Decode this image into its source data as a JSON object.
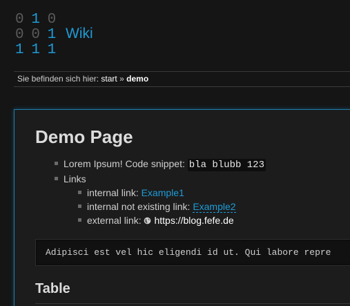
{
  "logo": {
    "rows": [
      [
        "0",
        "1",
        "0"
      ],
      [
        "0",
        "0",
        "1"
      ],
      [
        "1",
        "1",
        "1"
      ]
    ],
    "lit": [
      [
        false,
        true,
        false
      ],
      [
        false,
        false,
        true
      ],
      [
        true,
        true,
        true
      ]
    ]
  },
  "site": {
    "title": "Wiki"
  },
  "breadcrumb": {
    "prefix": "Sie befinden sich hier:",
    "start": "start",
    "separator": "»",
    "current": "demo"
  },
  "content": {
    "heading": "Demo Page",
    "item1_text": "Lorem Ipsum! Code snippet:",
    "item1_code": "bla blubb 123",
    "item2_text": "Links",
    "internal_label": "internal link:",
    "internal_link": "Example1",
    "missing_label": "internal not existing link:",
    "missing_link": "Example2",
    "external_label": "external link:",
    "external_link": "https://blog.fefe.de",
    "code_block": "Adipisci est vel hic eligendi id ut. Qui labore repre",
    "table_heading": "Table"
  },
  "colors": {
    "accent": "#1e9bd7",
    "background": "#151515",
    "panel": "#1c1c1c"
  }
}
